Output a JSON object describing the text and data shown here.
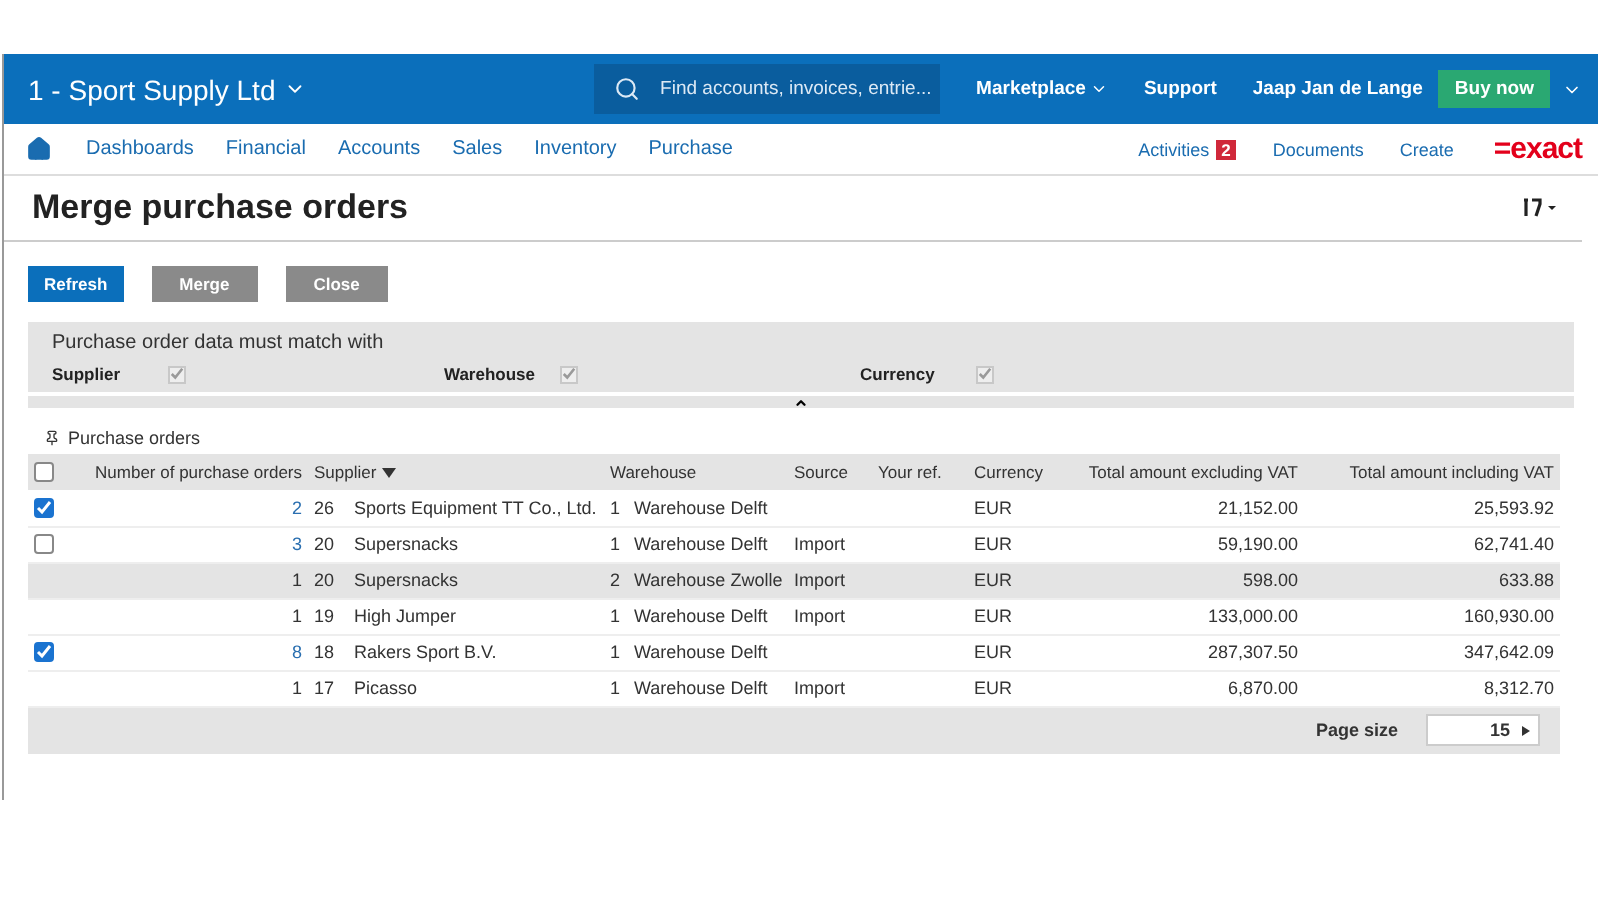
{
  "topbar": {
    "company": "1 - Sport Supply Ltd",
    "search": {
      "placeholder": "Find accounts, invoices, entrie..."
    },
    "links": [
      "Marketplace",
      "Support"
    ],
    "user": "Jaap Jan de Lange",
    "buy": "Buy now"
  },
  "nav": {
    "items": [
      "Dashboards",
      "Financial",
      "Accounts",
      "Sales",
      "Inventory",
      "Purchase"
    ],
    "activities": {
      "label": "Activities",
      "count": "2"
    },
    "right": [
      "Documents",
      "Create"
    ],
    "logo": "=exact"
  },
  "page": {
    "title": "Merge purchase orders"
  },
  "buttons": [
    {
      "label": "Refresh",
      "kind": "primary"
    },
    {
      "label": "Merge",
      "kind": "secondary"
    },
    {
      "label": "Close",
      "kind": "secondary"
    }
  ],
  "filter": {
    "heading": "Purchase order data must match with",
    "options": [
      {
        "label": "Supplier",
        "checked": true,
        "disabled": true
      },
      {
        "label": "Warehouse",
        "checked": true,
        "disabled": true
      },
      {
        "label": "Currency",
        "checked": true,
        "disabled": true
      }
    ]
  },
  "section": {
    "title": "Purchase orders"
  },
  "table": {
    "header_checked": false,
    "columns": [
      "Number of purchase orders",
      "Supplier",
      "Warehouse",
      "Source",
      "Your ref.",
      "Currency",
      "Total amount excluding VAT",
      "Total amount including VAT"
    ],
    "rows": [
      {
        "kind": "group",
        "checked": true,
        "selected": false,
        "count": "2",
        "supplier_code": "26",
        "supplier": "Sports Equipment TT Co., Ltd.",
        "warehouse_code": "1",
        "warehouse": "Warehouse Delft",
        "source": "",
        "currency": "EUR",
        "excl": "21,152.00",
        "incl": "25,593.92"
      },
      {
        "kind": "group",
        "checked": false,
        "selected": false,
        "count": "3",
        "supplier_code": "20",
        "supplier": "Supersnacks",
        "warehouse_code": "1",
        "warehouse": "Warehouse Delft",
        "source": "Import",
        "currency": "EUR",
        "excl": "59,190.00",
        "incl": "62,741.40"
      },
      {
        "kind": "single",
        "selected": true,
        "count": "1",
        "supplier_code": "20",
        "supplier": "Supersnacks",
        "warehouse_code": "2",
        "warehouse": "Warehouse Zwolle",
        "source": "Import",
        "currency": "EUR",
        "excl": "598.00",
        "incl": "633.88"
      },
      {
        "kind": "single",
        "selected": false,
        "count": "1",
        "supplier_code": "19",
        "supplier": "High Jumper",
        "warehouse_code": "1",
        "warehouse": "Warehouse Delft",
        "source": "Import",
        "currency": "EUR",
        "excl": "133,000.00",
        "incl": "160,930.00"
      },
      {
        "kind": "group",
        "checked": true,
        "selected": false,
        "count": "8",
        "supplier_code": "18",
        "supplier": "Rakers Sport B.V.",
        "warehouse_code": "1",
        "warehouse": "Warehouse Delft",
        "source": "",
        "currency": "EUR",
        "excl": "287,307.50",
        "incl": "347,642.09"
      },
      {
        "kind": "single",
        "selected": false,
        "count": "1",
        "supplier_code": "17",
        "supplier": "Picasso",
        "warehouse_code": "1",
        "warehouse": "Warehouse Delft",
        "source": "Import",
        "currency": "EUR",
        "excl": "6,870.00",
        "incl": "8,312.70"
      }
    ],
    "page_size": {
      "label": "Page size",
      "value": "15"
    }
  }
}
